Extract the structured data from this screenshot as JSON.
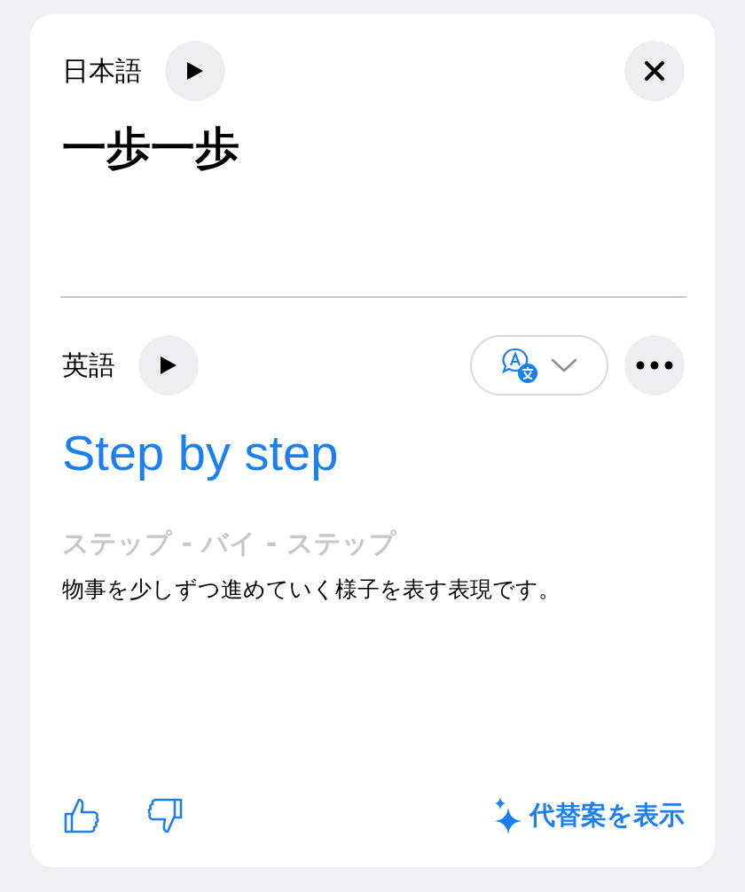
{
  "source": {
    "language": "日本語",
    "text": "一歩一歩"
  },
  "target": {
    "language": "英語",
    "text": "Step by step",
    "reading": "ステップ - バイ - ステップ",
    "note": "物事を少しずつ進めていく様子を表す表現です。"
  },
  "footer": {
    "alternatives": "代替案を表示"
  }
}
